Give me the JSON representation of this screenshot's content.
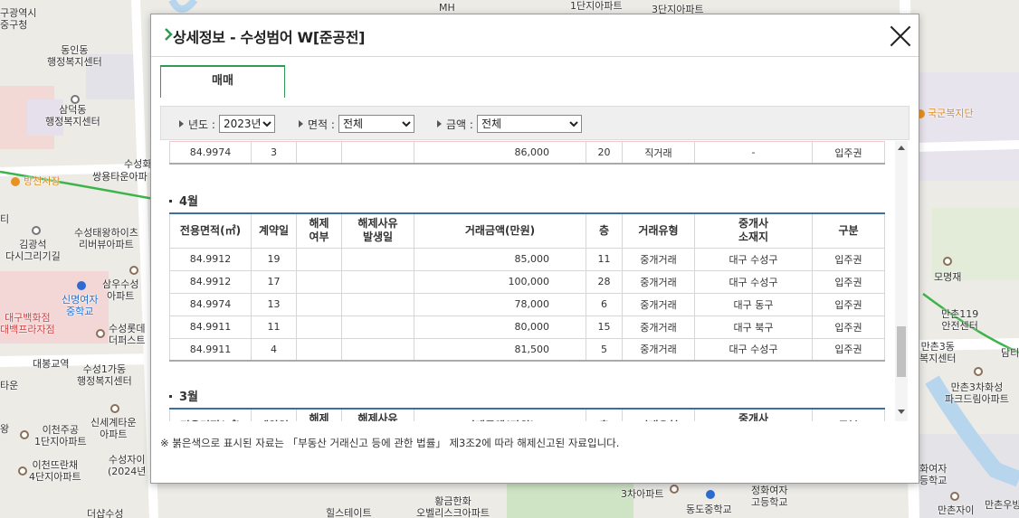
{
  "map": {
    "labels": [
      {
        "text": "구광역시\n중구청",
        "cls": ""
      },
      {
        "text": "동인동\n행정복지센터",
        "cls": ""
      },
      {
        "text": "삼덕동\n행정복지센터",
        "cls": ""
      },
      {
        "text": "수성화",
        "cls": ""
      },
      {
        "text": "쌍용타운아파",
        "cls": ""
      },
      {
        "text": "방천시장",
        "cls": "orange"
      },
      {
        "text": "김광석\n다시그리기길",
        "cls": ""
      },
      {
        "text": "수성태왕하이츠\n리버뷰아파트",
        "cls": ""
      },
      {
        "text": "삼우수성\n아파트",
        "cls": ""
      },
      {
        "text": "신명여자\n중학교",
        "cls": "blue"
      },
      {
        "text": "대구백화점\n대백프라자점",
        "cls": "red"
      },
      {
        "text": "수성롯데\n더퍼스트",
        "cls": ""
      },
      {
        "text": "대봉교역",
        "cls": ""
      },
      {
        "text": "수성1가동\n행정복지센터",
        "cls": ""
      },
      {
        "text": "신세계타운\n아파트",
        "cls": ""
      },
      {
        "text": "이천주공\n1단지아파트",
        "cls": ""
      },
      {
        "text": "이천뜨란채\n4단지아파트",
        "cls": ""
      },
      {
        "text": "수성자이\n(2024년",
        "cls": ""
      },
      {
        "text": "MH",
        "cls": ""
      },
      {
        "text": "1단지아파트",
        "cls": ""
      },
      {
        "text": "3단지아파트",
        "cls": ""
      },
      {
        "text": "국군복지단",
        "cls": "orange"
      },
      {
        "text": "모명재",
        "cls": ""
      },
      {
        "text": "만촌119\n안전센터",
        "cls": ""
      },
      {
        "text": "만촌3동\n복지센터",
        "cls": ""
      },
      {
        "text": "만촌3차화성\n파크드림아파트",
        "cls": ""
      },
      {
        "text": "담티",
        "cls": ""
      },
      {
        "text": "황금한화\n오벨리스크아파트",
        "cls": ""
      },
      {
        "text": "3차아파트",
        "cls": ""
      },
      {
        "text": "정화여자\n고등학교",
        "cls": ""
      },
      {
        "text": "동도중학교",
        "cls": ""
      },
      {
        "text": "힐스테이트",
        "cls": ""
      },
      {
        "text": "만촌자이",
        "cls": ""
      },
      {
        "text": "만촌우방",
        "cls": ""
      },
      {
        "text": "더샵수성",
        "cls": ""
      },
      {
        "text": "타운",
        "cls": ""
      },
      {
        "text": "티",
        "cls": ""
      },
      {
        "text": "왕",
        "cls": ""
      },
      {
        "text": "화여자\n등학교",
        "cls": ""
      }
    ]
  },
  "modal": {
    "title": "상세정보 - 수성범어 W[준공전]",
    "tab": "매매",
    "filters": {
      "year_label": "년도 :",
      "year_value": "2023년",
      "area_label": "면적 :",
      "area_value": "전체",
      "price_label": "금액 :",
      "price_value": "전체"
    },
    "columns": [
      "전용면적(㎡)",
      "계약일",
      "해제\n여부",
      "해제사유\n발생일",
      "거래금액(만원)",
      "층",
      "거래유형",
      "중개사\n소재지",
      "구분"
    ],
    "top_row": [
      "84.9974",
      "3",
      "",
      "",
      "86,000",
      "20",
      "직거래",
      "-",
      "입주권"
    ],
    "sections": [
      {
        "title": "4월",
        "rows": [
          [
            "84.9912",
            "19",
            "",
            "",
            "85,000",
            "11",
            "중개거래",
            "대구 수성구",
            "입주권"
          ],
          [
            "84.9912",
            "17",
            "",
            "",
            "100,000",
            "28",
            "중개거래",
            "대구 수성구",
            "입주권"
          ],
          [
            "84.9974",
            "13",
            "",
            "",
            "78,000",
            "6",
            "중개거래",
            "대구 동구",
            "입주권"
          ],
          [
            "84.9911",
            "11",
            "",
            "",
            "80,000",
            "15",
            "중개거래",
            "대구 북구",
            "입주권"
          ],
          [
            "84.9911",
            "4",
            "",
            "",
            "81,500",
            "5",
            "중개거래",
            "대구 수성구",
            "입주권"
          ]
        ]
      },
      {
        "title": "3월",
        "rows": []
      }
    ],
    "notice": "※ 붉은색으로 표시된 자료는 「부동산 거래신고 등에 관한 법률」 제3조2에 따라 해제신고된 자료입니다."
  }
}
